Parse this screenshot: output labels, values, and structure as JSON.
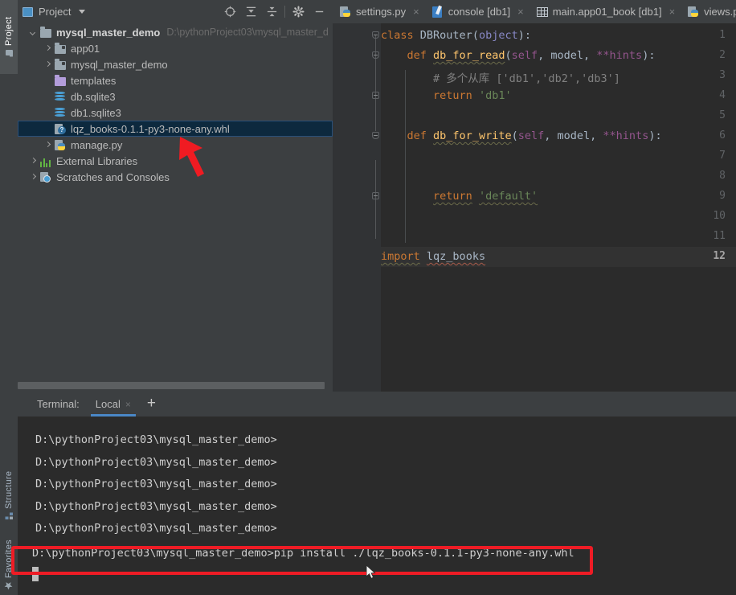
{
  "window": {
    "app": "PyCharm",
    "accent_blue": "#4a88c7",
    "selection_blue": "#0d293e",
    "annotation_red": "#ee1c25",
    "panel_bg": "#3c3f41",
    "editor_bg": "#2b2b2b"
  },
  "left_strip": {
    "tabs": [
      {
        "label": "Project",
        "icon": "project-icon",
        "selected": true
      },
      {
        "label": "Structure",
        "icon": "structure-icon",
        "selected": false
      },
      {
        "label": "Favorites",
        "icon": "star-icon",
        "selected": false
      }
    ]
  },
  "project_panel": {
    "title": "Project",
    "dropdown_icon": "chevron-down-icon",
    "toolbar": [
      {
        "name": "locate-icon",
        "glyph": "crosshair"
      },
      {
        "name": "expand-all-icon",
        "glyph": "expand"
      },
      {
        "name": "collapse-all-icon",
        "glyph": "collapse"
      },
      {
        "name": "settings-gear-icon",
        "glyph": "gear"
      },
      {
        "name": "hide-panel-icon",
        "glyph": "minus"
      }
    ],
    "tree": [
      {
        "label": "mysql_master_demo",
        "secondary": "D:\\pythonProject03\\mysql_master_d",
        "icon": "folder-icon",
        "indent": 0,
        "arrow": "down",
        "bold": true,
        "selected": false
      },
      {
        "label": "app01",
        "secondary": "",
        "icon": "module-folder-icon",
        "indent": 1,
        "arrow": "right",
        "bold": false,
        "selected": false
      },
      {
        "label": "mysql_master_demo",
        "secondary": "",
        "icon": "module-folder-icon",
        "indent": 1,
        "arrow": "right",
        "bold": false,
        "selected": false
      },
      {
        "label": "templates",
        "secondary": "",
        "icon": "templates-folder-icon",
        "indent": 1,
        "arrow": "none",
        "bold": false,
        "selected": false
      },
      {
        "label": "db.sqlite3",
        "secondary": "",
        "icon": "database-icon",
        "indent": 1,
        "arrow": "none",
        "bold": false,
        "selected": false
      },
      {
        "label": "db1.sqlite3",
        "secondary": "",
        "icon": "database-icon",
        "indent": 1,
        "arrow": "none",
        "bold": false,
        "selected": false
      },
      {
        "label": "lqz_books-0.1.1-py3-none-any.whl",
        "secondary": "",
        "icon": "wheel-file-icon",
        "indent": 1,
        "arrow": "none",
        "bold": false,
        "selected": true
      },
      {
        "label": "manage.py",
        "secondary": "",
        "icon": "python-file-icon",
        "indent": 1,
        "arrow": "right",
        "bold": false,
        "selected": false
      },
      {
        "label": "External Libraries",
        "secondary": "",
        "icon": "external-libraries-icon",
        "indent": 0,
        "arrow": "right",
        "bold": false,
        "selected": false
      },
      {
        "label": "Scratches and Consoles",
        "secondary": "",
        "icon": "scratches-icon",
        "indent": 0,
        "arrow": "right",
        "bold": false,
        "selected": false
      }
    ]
  },
  "editor": {
    "tabs": [
      {
        "label": "settings.py",
        "icon": "python-file-icon",
        "close": "×",
        "active": false
      },
      {
        "label": "console [db1]",
        "icon": "console-icon",
        "close": "×",
        "active": false
      },
      {
        "label": "main.app01_book [db1]",
        "icon": "table-icon",
        "close": "×",
        "active": false
      },
      {
        "label": "views.p",
        "icon": "python-file-icon",
        "close": "",
        "active": false
      }
    ],
    "current_line": 12,
    "line_numbers": [
      1,
      2,
      3,
      4,
      5,
      6,
      7,
      8,
      9,
      10,
      11,
      12
    ],
    "code_lines": [
      {
        "n": 1,
        "text": "class DBRouter(object):"
      },
      {
        "n": 2,
        "text": "    def db_for_read(self, model, **hints):"
      },
      {
        "n": 3,
        "text": "        # 多个从库 ['db1','db2','db3']"
      },
      {
        "n": 4,
        "text": "        return 'db1'"
      },
      {
        "n": 5,
        "text": ""
      },
      {
        "n": 6,
        "text": "    def db_for_write(self, model, **hints):"
      },
      {
        "n": 7,
        "text": ""
      },
      {
        "n": 8,
        "text": ""
      },
      {
        "n": 9,
        "text": "        return 'default'"
      },
      {
        "n": 10,
        "text": ""
      },
      {
        "n": 11,
        "text": ""
      },
      {
        "n": 12,
        "text": "import lqz_books"
      }
    ]
  },
  "terminal": {
    "label": "Terminal:",
    "tab_label": "Local",
    "tab_close": "×",
    "add_label": "+",
    "prompt": "D:\\pythonProject03\\mysql_master_demo>",
    "lines": [
      "D:\\pythonProject03\\mysql_master_demo>",
      "D:\\pythonProject03\\mysql_master_demo>",
      "D:\\pythonProject03\\mysql_master_demo>",
      "D:\\pythonProject03\\mysql_master_demo>",
      "D:\\pythonProject03\\mysql_master_demo>"
    ],
    "command_line": "D:\\pythonProject03\\mysql_master_demo>pip install ./lqz_books-0.1.1-py3-none-any.whl",
    "command": "pip install ./lqz_books-0.1.1-py3-none-any.whl"
  },
  "annotations": [
    {
      "name": "red-arrow-to-whl-file",
      "type": "arrow"
    },
    {
      "name": "red-box-around-pip-install-command",
      "type": "rect"
    }
  ]
}
